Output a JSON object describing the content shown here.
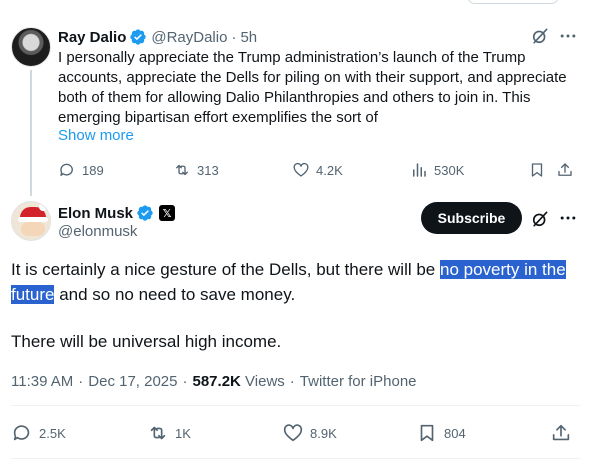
{
  "parent_tweet": {
    "author_name": "Ray Dalio",
    "handle": "@RayDalio",
    "separator": "·",
    "time": "5h",
    "text": "I personally appreciate the Trump administration’s launch of the Trump accounts, appreciate the Dells for piling on with their support, and appreciate both of them for allowing Dalio Philanthropies and others to join in.  This emerging bipartisan effort exemplifies the sort of",
    "show_more": "Show more",
    "actions": {
      "replies": "189",
      "reposts": "313",
      "likes": "4.2K",
      "views": "530K"
    }
  },
  "main_tweet": {
    "author_name": "Elon Musk",
    "handle": "@elonmusk",
    "subscribe_label": "Subscribe",
    "text_before_highlight": "It is certainly a nice gesture of the Dells, but there will be ",
    "text_highlight": "no poverty in the future",
    "text_after_highlight": " and so no need to save money.",
    "text_para2": "There will be universal high income.",
    "time": "11:39 AM",
    "date": "Dec 17, 2025",
    "separator": "·",
    "views_count": "587.2K",
    "views_label": "Views",
    "source": "Twitter for iPhone",
    "actions": {
      "replies": "2.5K",
      "reposts": "1K",
      "likes": "8.9K",
      "bookmarks": "804"
    }
  },
  "colors": {
    "accent": "#1d9bf0",
    "text": "#0f1419",
    "secondary": "#536471",
    "highlight": "#2a62d0",
    "verified": "#1d9bf0"
  }
}
